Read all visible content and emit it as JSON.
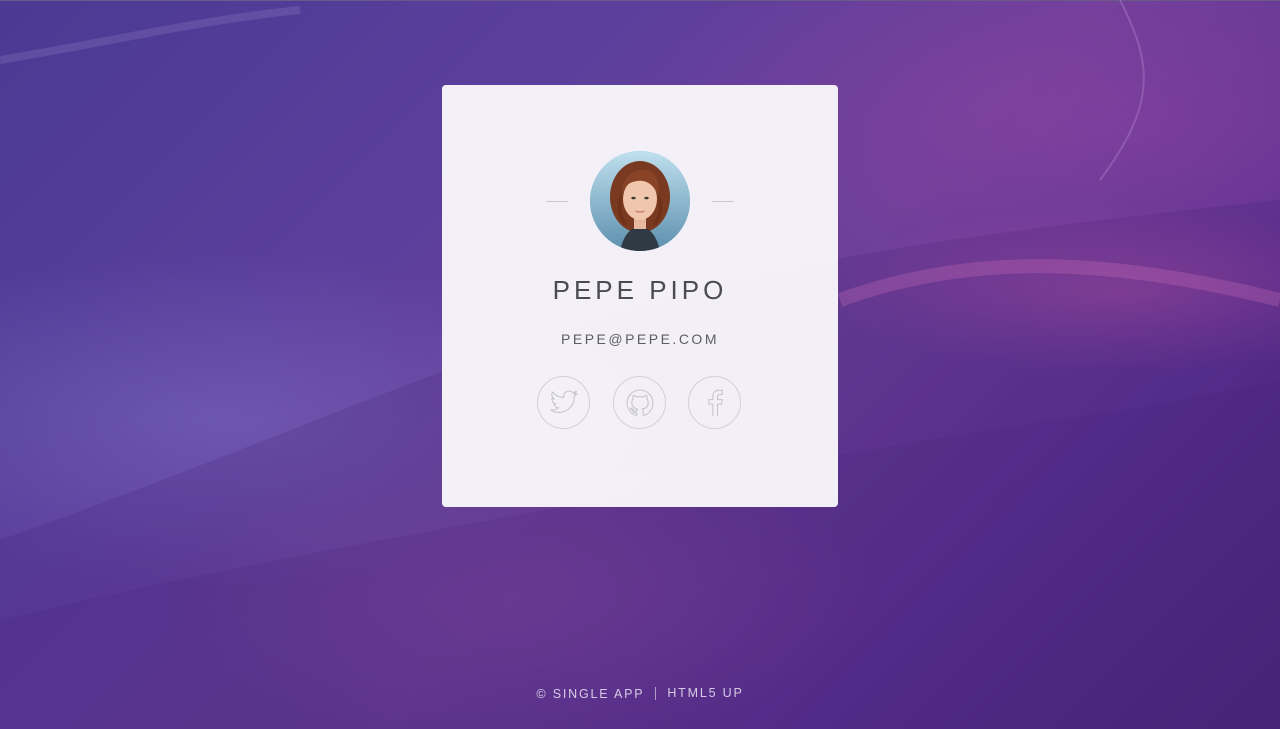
{
  "profile": {
    "name": "PEPE PIPO",
    "email": "PEPE@PEPE.COM"
  },
  "socials": [
    {
      "icon": "twitter-icon",
      "label": "Twitter"
    },
    {
      "icon": "github-icon",
      "label": "GitHub"
    },
    {
      "icon": "facebook-icon",
      "label": "Facebook"
    }
  ],
  "footer": {
    "copyright": "© SINGLE APP",
    "credit": "HTML5 UP"
  },
  "colors": {
    "background_top": "#4a3a93",
    "background_bottom": "#4a2677",
    "card": "#f8f6fa",
    "text": "#4b4a55",
    "icon_stroke": "#c8c6cd"
  }
}
